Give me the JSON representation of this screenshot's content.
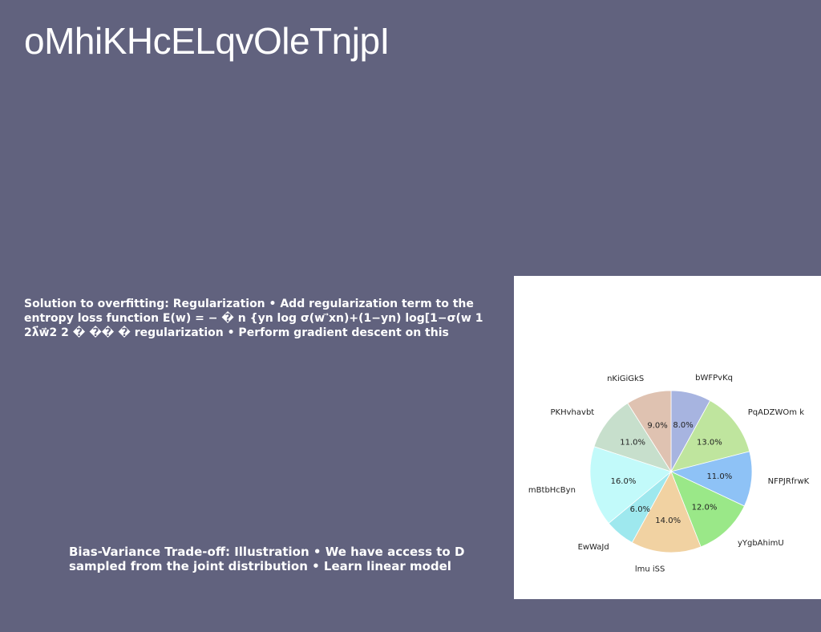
{
  "slide": {
    "title": "oMhiKHcELqvOleTnjpI",
    "paragraph_a": "Solution to overfitting: Regularization • Add regularization term to the entropy loss function E(w) = − � n {yn log σ(w ⃗xn)+(1−yn) log[1−σ(w 1 2λ⃗w⃗2 2 � �� � regularization • Perform gradient descent on this",
    "paragraph_b": "Bias-Variance Trade-off: Illustration • We have access to D sampled from the joint distribution • Learn linear model"
  },
  "chart_data": {
    "type": "pie",
    "title": "",
    "start_angle_deg": 90,
    "direction": "clockwise",
    "slices": [
      {
        "label": "bWFPvKq",
        "value": 8.0,
        "pct_text": "8.0%",
        "color": "#a7b4e0"
      },
      {
        "label": "PqADZWOm k",
        "value": 13.0,
        "pct_text": "13.0%",
        "color": "#bfe59e"
      },
      {
        "label": "NFPJRfrwK",
        "value": 11.0,
        "pct_text": "11.0%",
        "color": "#8ec2f6"
      },
      {
        "label": "yYgbAhimU",
        "value": 12.0,
        "pct_text": "12.0%",
        "color": "#9ae888"
      },
      {
        "label": "lmu iSS",
        "value": 14.0,
        "pct_text": "14.0%",
        "color": "#f1d2a2"
      },
      {
        "label": "EwWaJd",
        "value": 6.0,
        "pct_text": "6.0%",
        "color": "#9ee8ee"
      },
      {
        "label": "mBtbHcByn",
        "value": 16.0,
        "pct_text": "16.0%",
        "color": "#c2fafa"
      },
      {
        "label": "PKHvhavbt",
        "value": 11.0,
        "pct_text": "11.0%",
        "color": "#c7dfcc"
      },
      {
        "label": "nKiGiGkS",
        "value": 9.0,
        "pct_text": "9.0%",
        "color": "#dfc2b1"
      }
    ]
  }
}
